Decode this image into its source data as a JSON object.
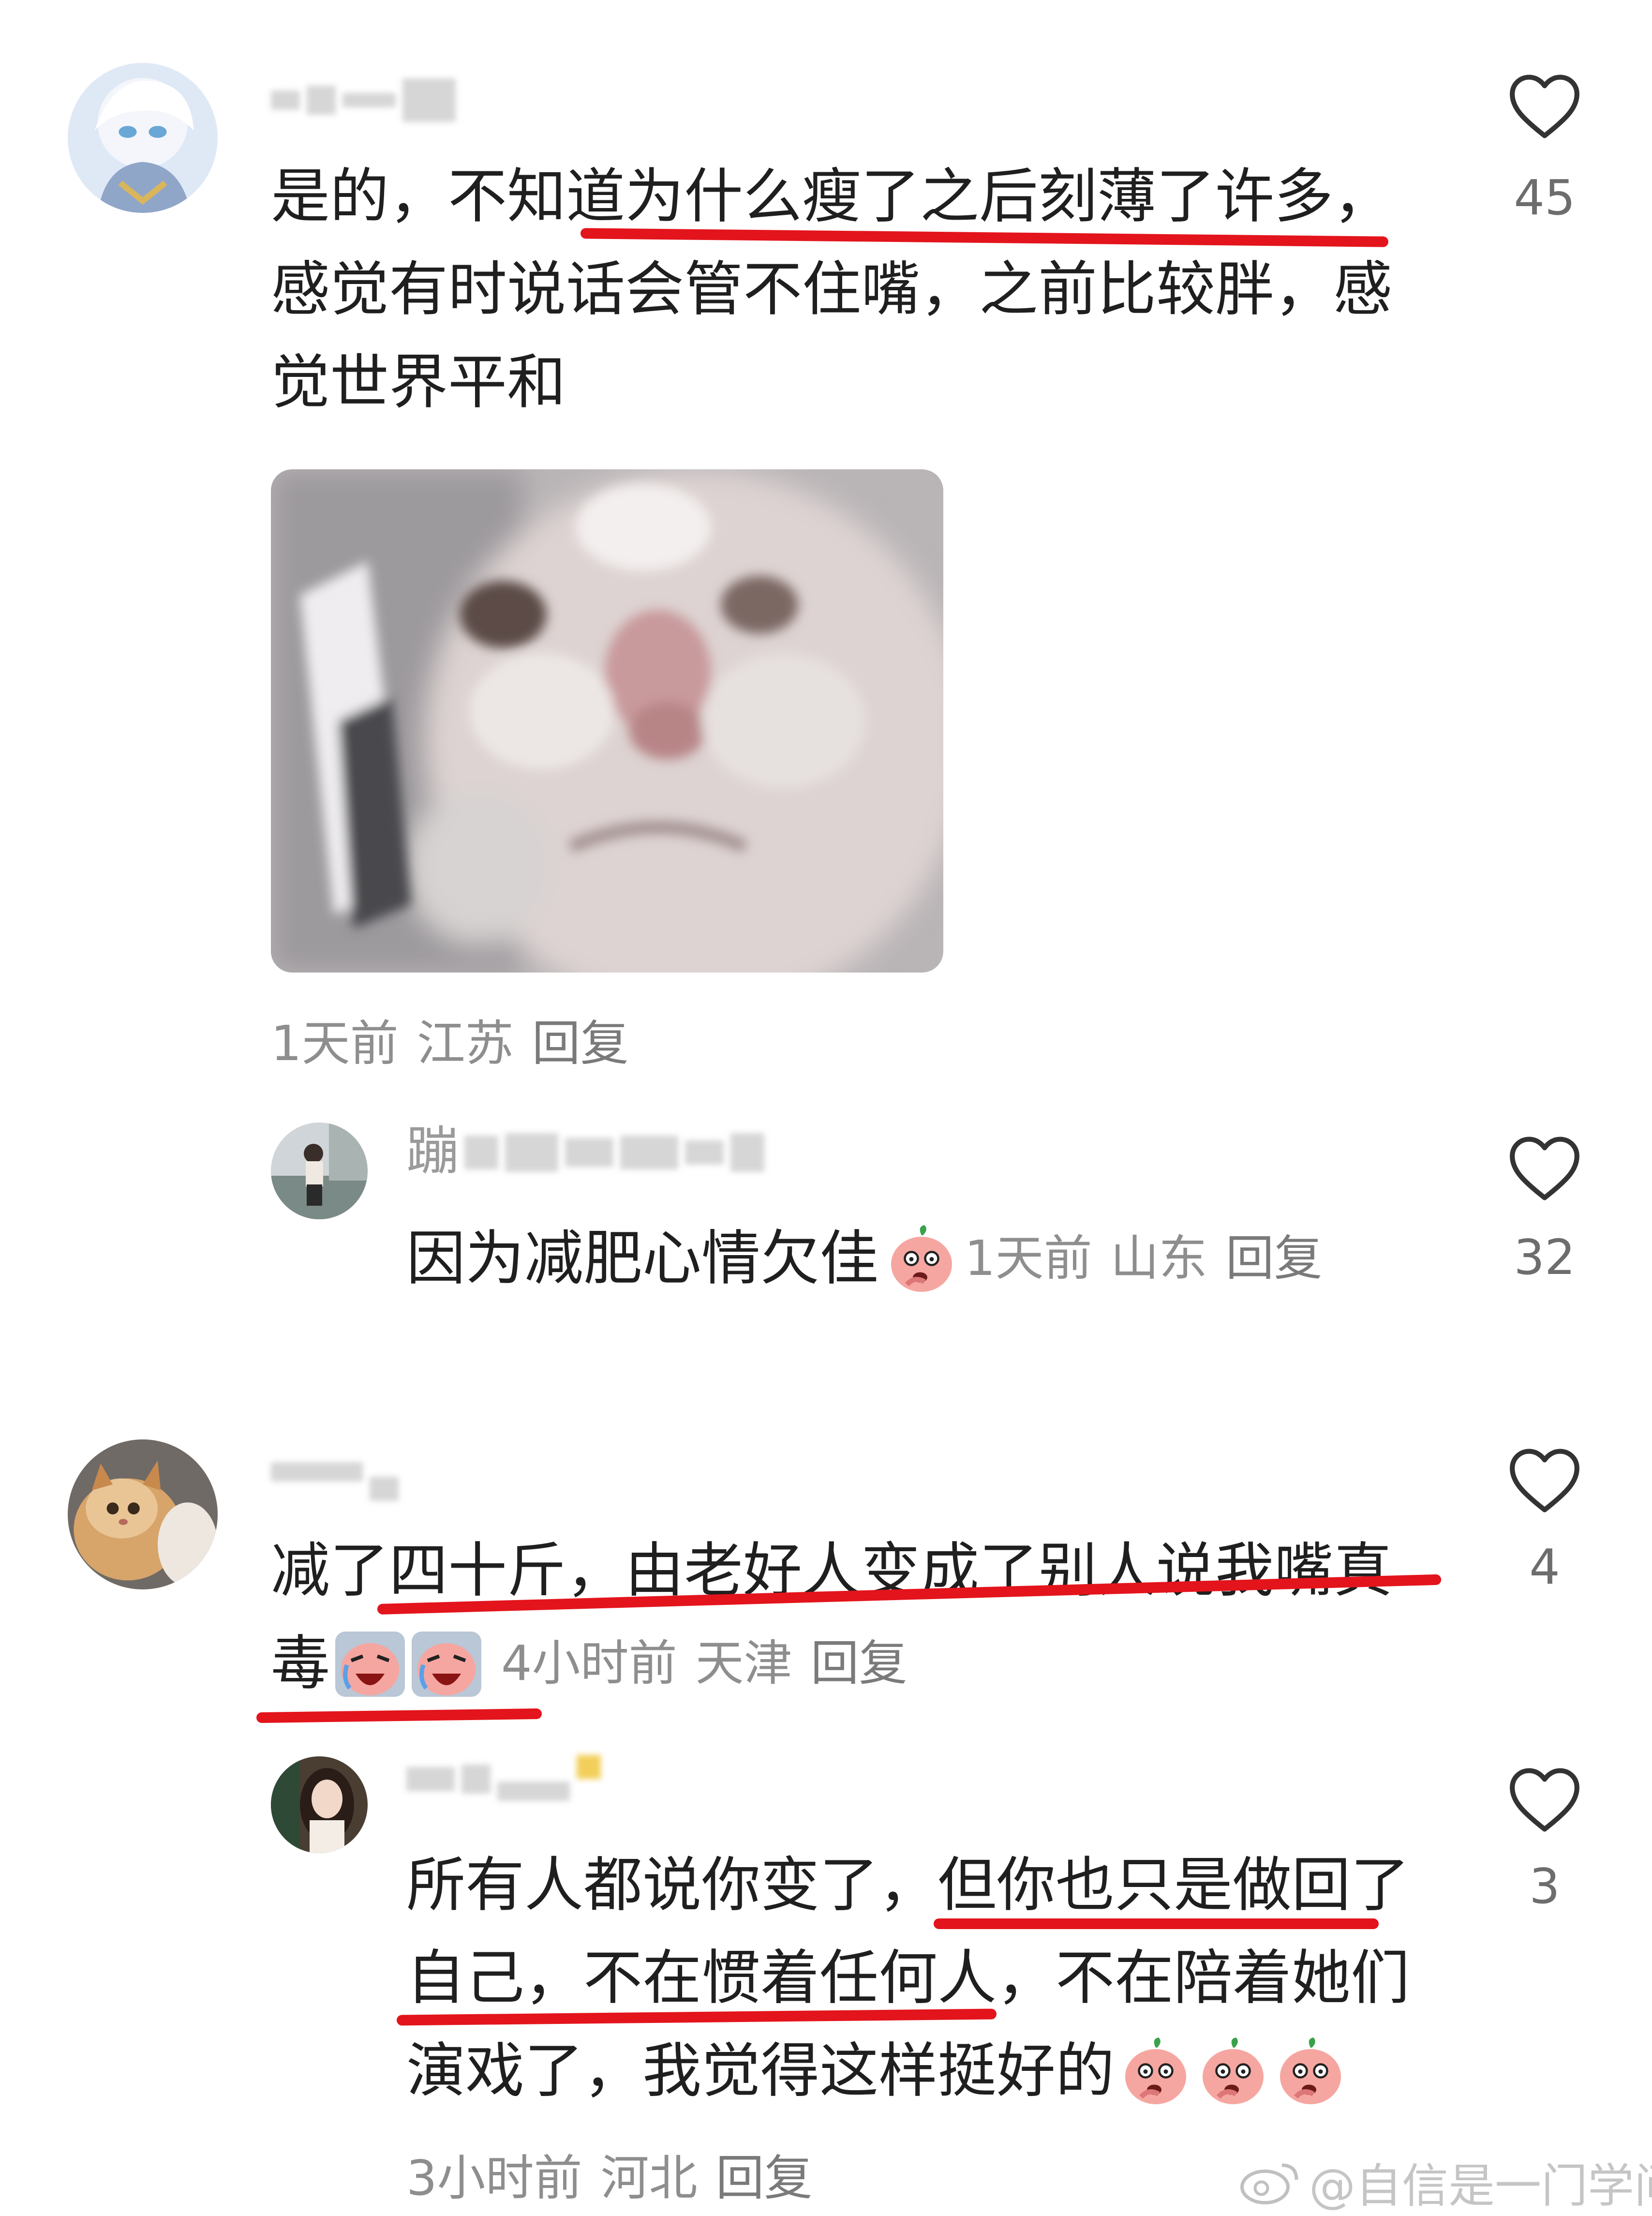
{
  "comments": [
    {
      "text_lines": [
        "是的，不知道为什么瘦了之后刻薄了许多，",
        "感觉有时说话会管不住嘴，之前比较胖，感",
        "觉世界平和"
      ],
      "time": "1天前",
      "location": "江苏",
      "reply_label": "回复",
      "likes": "45",
      "has_image": true,
      "reply": {
        "name_visible": "蹦",
        "text": "因为减肥心情欠佳",
        "time": "1天前",
        "location": "山东",
        "reply_label": "回复",
        "likes": "32",
        "emoji": "doubt-emoji"
      }
    },
    {
      "text_lines": [
        "减了四十斤，由老好人变成了别人说我嘴真",
        "毒"
      ],
      "time": "4小时前",
      "location": "天津",
      "reply_label": "回复",
      "likes": "4",
      "emoji": "laugh-cry-emoji",
      "reply": {
        "text_lines": [
          "所有人都说你变了，但你也只是做回了",
          "自己，不在惯着任何人，不在陪着她们",
          "演戏了，我觉得这样挺好的"
        ],
        "time": "3小时前",
        "location": "河北",
        "reply_label": "回复",
        "likes": "3",
        "emoji": "doubt-emoji"
      }
    }
  ],
  "watermark": "@自信是一门学问",
  "colors": {
    "highlight": "#e3141c",
    "meta": "#8e8e8e",
    "text": "#1f1f1f"
  }
}
